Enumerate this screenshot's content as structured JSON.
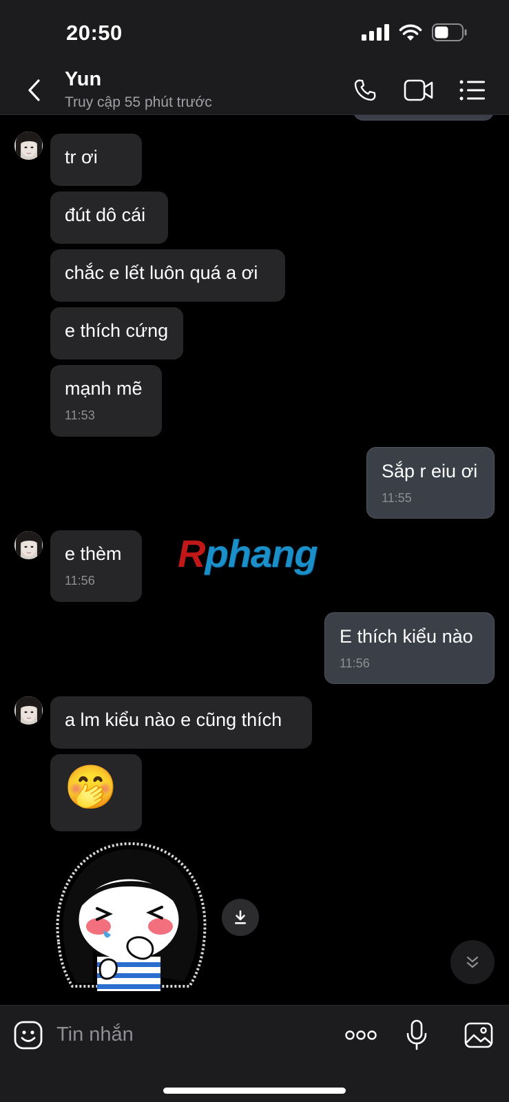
{
  "status_bar": {
    "time": "20:50"
  },
  "header": {
    "contact_name": "Yun",
    "contact_status": "Truy cập 55 phút trước"
  },
  "messages": [
    {
      "dir": "in",
      "text": "tr ơi"
    },
    {
      "dir": "in",
      "text": "đút dô cái"
    },
    {
      "dir": "in",
      "text": "chắc e lết luôn quá a ơi"
    },
    {
      "dir": "in",
      "text": "e thích cứng"
    },
    {
      "dir": "in",
      "text": "mạnh mẽ",
      "time": "11:53"
    },
    {
      "dir": "out",
      "text": "Sắp r eiu ơi",
      "time": "11:55"
    },
    {
      "dir": "in",
      "text": "e thèm",
      "time": "11:56"
    },
    {
      "dir": "out",
      "text": "E thích kiểu nào",
      "time": "11:56"
    },
    {
      "dir": "in",
      "text": "a lm kiểu nào e cũng thích"
    },
    {
      "dir": "in",
      "emoji": "🤭"
    }
  ],
  "watermark": {
    "first": "R",
    "rest": "phang"
  },
  "input": {
    "placeholder": "Tin nhắn"
  },
  "colors": {
    "incoming_bubble": "#262628",
    "outgoing_bubble": "#3a3f48",
    "background": "#000000",
    "watermark_red": "#c01818",
    "watermark_blue": "#1a8fc8"
  }
}
